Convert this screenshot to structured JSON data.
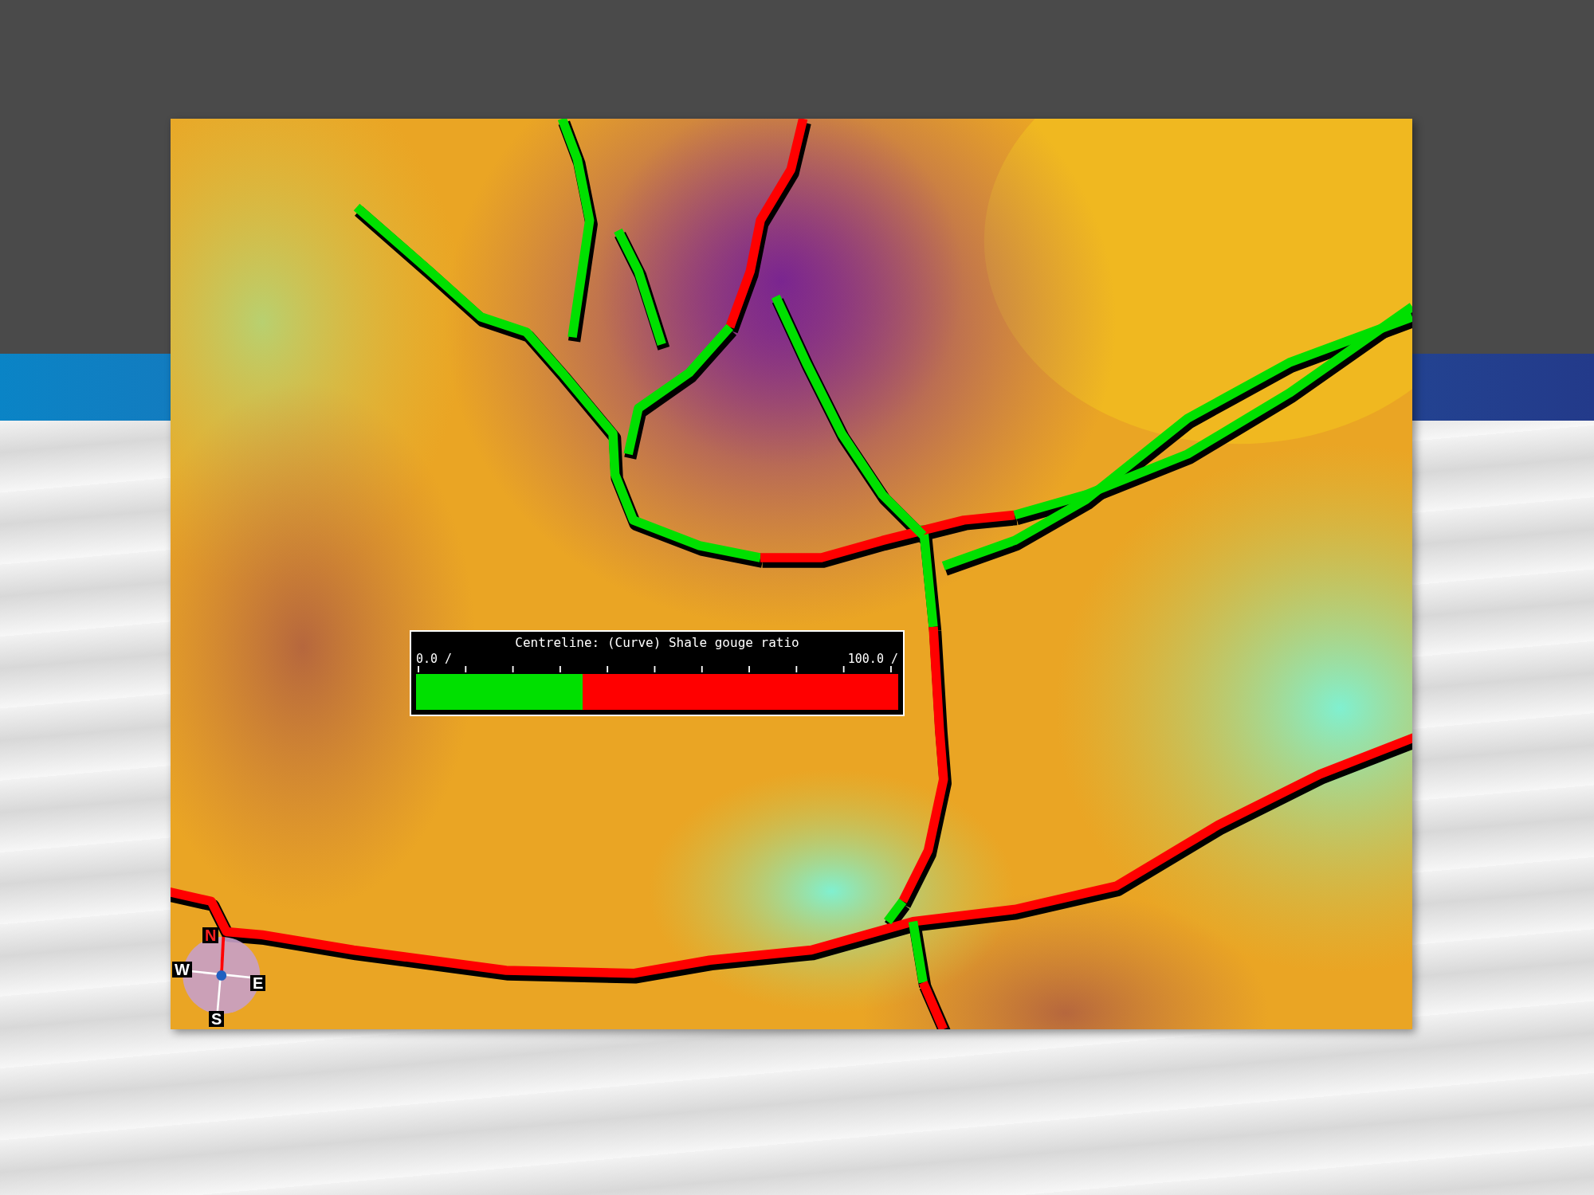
{
  "legend": {
    "title": "Centreline: (Curve) Shale gouge ratio",
    "min_label": "0.0 /",
    "max_label": "100.0 /",
    "level": 0.345
  },
  "compass": {
    "labels": [
      {
        "kind": "north",
        "text": "N"
      },
      {
        "kind": "west",
        "text": "W"
      },
      {
        "kind": "east",
        "text": "E"
      },
      {
        "kind": "south",
        "text": "S"
      }
    ]
  }
}
